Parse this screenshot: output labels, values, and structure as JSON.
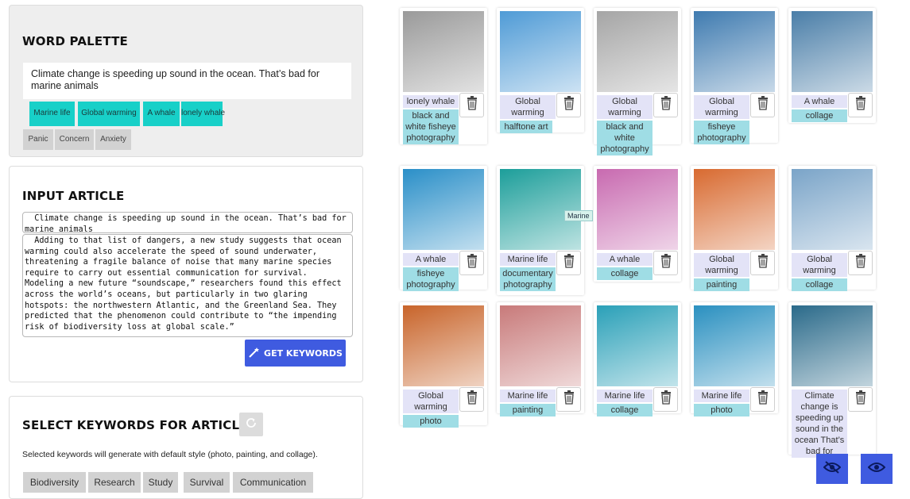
{
  "word_palette": {
    "title": "WORD PALETTE",
    "sentence": "Climate change is speeding up sound in the ocean. That’s bad for marine animals",
    "keywords": [
      "Marine life",
      "Global warming",
      "A whale",
      "lonely whale"
    ],
    "emotions": [
      "Panic",
      "Concern",
      "Anxiety"
    ]
  },
  "input_article": {
    "title": "INPUT ARTICLE",
    "headline": "  Climate change is speeding up sound in the ocean. That’s bad for marine animals",
    "body": "  Adding to that list of dangers, a new study suggests that ocean warming could also accelerate the speed of sound underwater, threatening a fragile balance of noise that many marine species require to carry out essential communication for survival. Modeling a new future “soundscape,” researchers found this effect across the world’s oceans, but particularly in two glaring hotspots: the northwestern Atlantic, and the Greenland Sea. They predicted that the phenomenon could contribute to “the impending risk of biodiversity loss at global scale.”",
    "button_label": "GET KEYWORDS"
  },
  "select_keywords": {
    "title": "SELECT KEYWORDS FOR ARTICLE",
    "note": "Selected keywords will generate with default style (photo, painting, and collage).",
    "chips": [
      "Biodiversity",
      "Research",
      "Study",
      "Survival",
      "Communication"
    ]
  },
  "tooltip": "Marine",
  "gallery": [
    {
      "keyword": "lonely whale",
      "style": "black and white fisheye photography"
    },
    {
      "keyword": "Global warming",
      "style": "halftone art"
    },
    {
      "keyword": "Global warming",
      "style": "black and white photography"
    },
    {
      "keyword": "Global warming",
      "style": "fisheye photography"
    },
    {
      "keyword": "A whale",
      "style": "collage"
    },
    {
      "keyword": "A whale",
      "style": "fisheye photography"
    },
    {
      "keyword": "Marine life",
      "style": "documentary photography"
    },
    {
      "keyword": "A whale",
      "style": "collage"
    },
    {
      "keyword": "Global warming",
      "style": "painting"
    },
    {
      "keyword": "Global warming",
      "style": "collage"
    },
    {
      "keyword": "Global warming",
      "style": "photo"
    },
    {
      "keyword": "Marine life",
      "style": "painting"
    },
    {
      "keyword": "Marine life",
      "style": "collage"
    },
    {
      "keyword": "Marine life",
      "style": "photo"
    },
    {
      "keyword": "Climate change is speeding up sound in the ocean That’s bad for",
      "style": ""
    }
  ],
  "colors": {
    "accent": "#3f5be0",
    "chip_cyan": "#18d0c8",
    "keyword_bg": "#e3e3f7",
    "style_bg": "#9fdde5"
  },
  "icons": [
    "magic-wand-icon",
    "refresh-icon",
    "trash-icon",
    "eye-off-icon",
    "eye-icon"
  ]
}
